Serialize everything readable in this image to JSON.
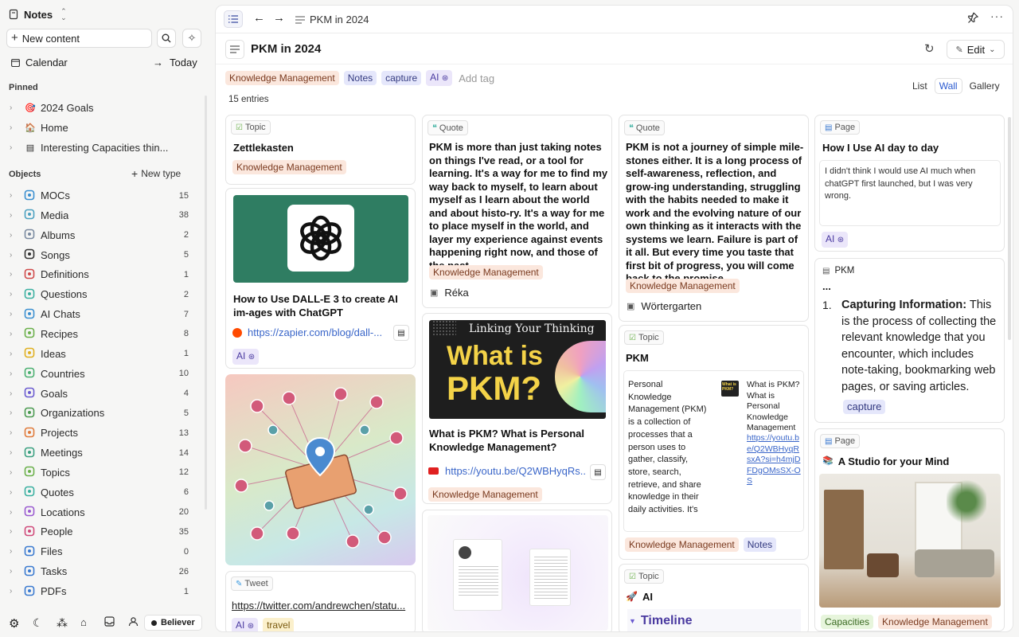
{
  "sidebar": {
    "workspace": "Notes",
    "new_content": "New content",
    "calendar": "Calendar",
    "today": "Today",
    "pinned_header": "Pinned",
    "pinned": [
      {
        "label": "2024 Goals",
        "icon": "dart-icon"
      },
      {
        "label": "Home",
        "icon": "house-icon"
      },
      {
        "label": "Interesting Capacities thin...",
        "icon": "page-icon"
      }
    ],
    "objects_header": "Objects",
    "new_type": "New type",
    "objects": [
      {
        "label": "MOCs",
        "count": "15",
        "icon": "map-icon",
        "color": "#3a8fd0"
      },
      {
        "label": "Media",
        "count": "38",
        "icon": "media-icon",
        "color": "#4aa0c0"
      },
      {
        "label": "Albums",
        "count": "2",
        "icon": "album-icon",
        "color": "#7a8aa0"
      },
      {
        "label": "Songs",
        "count": "5",
        "icon": "music-icon",
        "color": "#333333"
      },
      {
        "label": "Definitions",
        "count": "1",
        "icon": "book-icon",
        "color": "#d04a4a"
      },
      {
        "label": "Questions",
        "count": "2",
        "icon": "question-icon",
        "color": "#3ab0a0"
      },
      {
        "label": "AI Chats",
        "count": "7",
        "icon": "chat-icon",
        "color": "#3a8fd0"
      },
      {
        "label": "Recipes",
        "count": "8",
        "icon": "recipe-icon",
        "color": "#6ab04a"
      },
      {
        "label": "Ideas",
        "count": "1",
        "icon": "bulb-icon",
        "color": "#e0b020"
      },
      {
        "label": "Countries",
        "count": "10",
        "icon": "globe-icon",
        "color": "#4ab070"
      },
      {
        "label": "Goals",
        "count": "4",
        "icon": "target-icon",
        "color": "#6a5ad0"
      },
      {
        "label": "Organizations",
        "count": "5",
        "icon": "building-icon",
        "color": "#4a9a50"
      },
      {
        "label": "Projects",
        "count": "13",
        "icon": "box-icon",
        "color": "#e07a3a"
      },
      {
        "label": "Meetings",
        "count": "14",
        "icon": "meeting-icon",
        "color": "#3aa080"
      },
      {
        "label": "Topics",
        "count": "12",
        "icon": "topic-icon",
        "color": "#6ab04a"
      },
      {
        "label": "Quotes",
        "count": "6",
        "icon": "quote-icon",
        "color": "#3ab0a0"
      },
      {
        "label": "Locations",
        "count": "20",
        "icon": "pin-icon",
        "color": "#9a5ad0"
      },
      {
        "label": "People",
        "count": "35",
        "icon": "person-icon",
        "color": "#d04a7a"
      },
      {
        "label": "Files",
        "count": "0",
        "icon": "file-icon",
        "color": "#3a7ad0"
      },
      {
        "label": "Tasks",
        "count": "26",
        "icon": "task-icon",
        "color": "#3a7ad0"
      },
      {
        "label": "PDFs",
        "count": "1",
        "icon": "pdf-icon",
        "color": "#3a7ad0"
      }
    ],
    "footer_badge": "Believer"
  },
  "header": {
    "breadcrumb": "PKM in 2024"
  },
  "page": {
    "title": "PKM in 2024",
    "edit": "Edit",
    "tags": [
      "Knowledge Management",
      "Notes",
      "capture",
      "AI"
    ],
    "add_tag": "Add tag",
    "view_options": [
      "List",
      "Wall",
      "Gallery"
    ],
    "active_view": "Wall",
    "entries": "15 entries"
  },
  "cards": {
    "zettel": {
      "type": "Topic",
      "title": "Zettlekasten",
      "tag": "Knowledge Management"
    },
    "dalle": {
      "title": "How to Use DALL-E 3 to create AI im-ages with ChatGPT",
      "link": "https://zapier.com/blog/dall-...",
      "tag": "AI"
    },
    "tweet": {
      "type": "Tweet",
      "link": "https://twitter.com/andrewchen/statu...",
      "tags": [
        "AI",
        "travel"
      ]
    },
    "quote1": {
      "type": "Quote",
      "body": "PKM is more than just taking notes on things I've read, or a tool for learning. It's a way for me to find my way back to myself, to learn about myself as I learn about the world and about histo-ry. It's a way for me to place myself in the world, and layer my experience against events happening right now, and those of the past",
      "tag": "Knowledge Management",
      "author": "Réka"
    },
    "video": {
      "banner": "Linking Your Thinking",
      "big1": "What is",
      "big2": "PKM?",
      "title": "What is PKM? What is Personal Knowledge Management?",
      "link": "https://youtu.be/Q2WBHyqRs...",
      "tag": "Knowledge Management"
    },
    "quote2": {
      "type": "Quote",
      "body": "PKM is not a journey of simple mile-stones either. It is a long process of self-awareness, reflection, and grow-ing understanding, struggling with the habits needed to make it work and the evolving nature of our own thinking as it interacts with the systems we learn. Failure is part of it all. But every time you taste that first bit of progress, you will come back to the promise.",
      "tag": "Knowledge Management",
      "author": "Wörtergarten"
    },
    "pkm_topic": {
      "type": "Topic",
      "title": "PKM",
      "desc": "Personal Knowledge Management (PKM) is a collection of processes that a person uses to gather, classify, store, search, retrieve, and share knowledge in their daily activities. It's",
      "ref_title": "What is PKM? What is Personal Knowledge Management",
      "ref_link": "https://youtu.be/Q2WBHyqRsxA?si=h4mjDFDgOMsSX-OS",
      "thumb": "What is PKM?",
      "tags": [
        "Knowledge Management",
        "Notes"
      ]
    },
    "ai_topic": {
      "type": "Topic",
      "title": "AI",
      "timeline": "Timeline"
    },
    "page_ai": {
      "type": "Page",
      "title": "How I Use AI day to day",
      "excerpt": "I didn't think I would use AI much when chatGPT first launched, but I was very wrong.",
      "tag": "AI"
    },
    "pkm_block": {
      "label": "PKM",
      "ellipsis": "...",
      "num": "1.",
      "bold": "Capturing Information:",
      "text": " This is the process of collecting the relevant knowledge that you encounter, which includes note-taking, bookmarking web pages, or saving articles.",
      "tag": "capture"
    },
    "studio": {
      "type": "Page",
      "title": "A Studio for your Mind",
      "tags": [
        "Capacities",
        "Knowledge Management"
      ]
    }
  }
}
